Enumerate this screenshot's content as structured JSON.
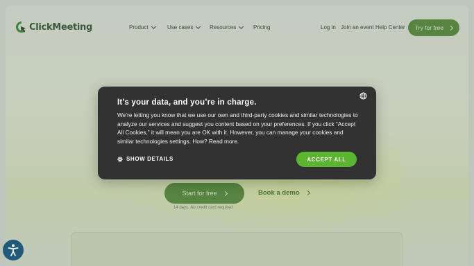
{
  "brand": {
    "name": "ClickMeeting",
    "color": "#3e5a3e",
    "accent": "#5b8a44"
  },
  "nav": {
    "items": [
      {
        "label": "Product",
        "dropdown": true
      },
      {
        "label": "Use cases",
        "dropdown": true
      },
      {
        "label": "Resources",
        "dropdown": true
      },
      {
        "label": "Pricing",
        "dropdown": false
      }
    ],
    "login": "Log in",
    "join": "Join an event",
    "help": "Help Center",
    "cta": "Try for free"
  },
  "hero": {
    "start_label": "Start for free",
    "demo_label": "Book a demo",
    "trial_note": "14 days. No credit card required"
  },
  "cookie_modal": {
    "title": "It’s your data, and you’re in charge.",
    "body": "We’re letting you know that we use our own and third-party cookies and similar technologies to analyze our services and suggest you content based on your preferences. If you click “Accept All Cookies,” it will mean you are OK with it. However, you can manage your cookies and similar technologies settings. How? Read more.",
    "show_details": "SHOW DETAILS",
    "accept_all": "ACCEPT ALL",
    "accept_color": "#5cb531",
    "background": "#323232"
  },
  "icons": [
    "clickmeeting-logo-icon",
    "chevron-down-icon",
    "chevron-right-icon",
    "globe-icon",
    "gear-icon",
    "accessibility-icon"
  ]
}
